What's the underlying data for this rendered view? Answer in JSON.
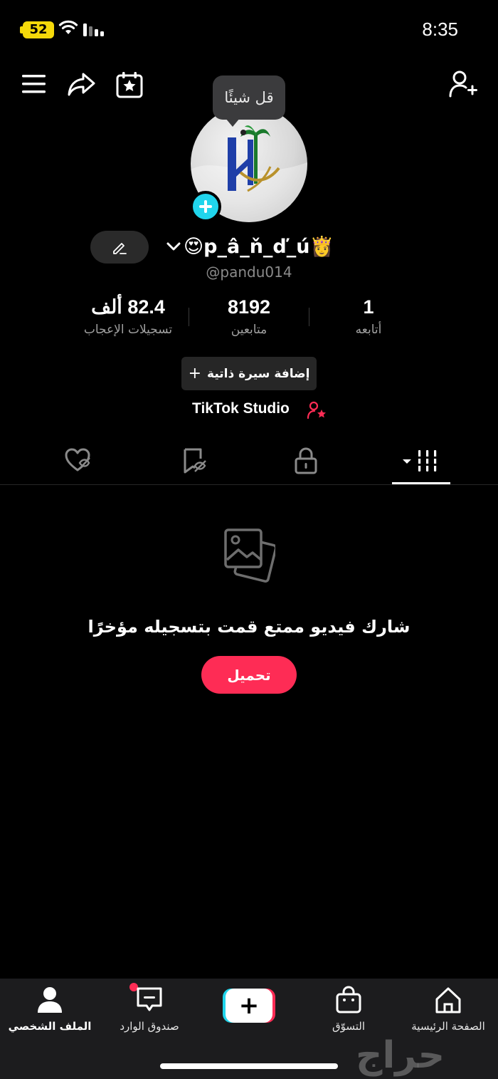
{
  "status_bar": {
    "battery_level": "52",
    "time": "8:35"
  },
  "top_bar": {
    "icons": [
      "menu-icon",
      "share-icon",
      "calendar-star-icon",
      "add-user-icon"
    ]
  },
  "profile": {
    "tooltip": "قل شيئًا",
    "display_name": "😍p_â_ň_ď_ú👸",
    "username": "@pandu014",
    "stats": {
      "likes_value": "82.4 ألف",
      "likes_label": "تسجيلات الإعجاب",
      "followers_value": "8192",
      "followers_label": "متابعين",
      "following_value": "1",
      "following_label": "أتابعه"
    },
    "add_bio_label": "إضافة سيرة ذاتية",
    "studio_label": "TikTok Studio"
  },
  "tabs": [
    "liked-hidden-icon",
    "favorites-hidden-icon",
    "lock-icon",
    "videos-grid-icon"
  ],
  "empty_state": {
    "message": "شارك فيديو ممتع قمت بتسجيله مؤخرًا",
    "upload_label": "تحميل"
  },
  "bottom_nav": {
    "profile_label": "الملف الشخصي",
    "inbox_label": "صندوق الوارد",
    "create_label": "+",
    "shop_label": "التسوّق",
    "home_label": "الصفحة الرئيسية"
  },
  "watermark": "حراج",
  "colors": {
    "accent_red": "#fe2c55",
    "accent_cyan": "#20d5ec",
    "battery_yellow": "#f5d90a"
  }
}
